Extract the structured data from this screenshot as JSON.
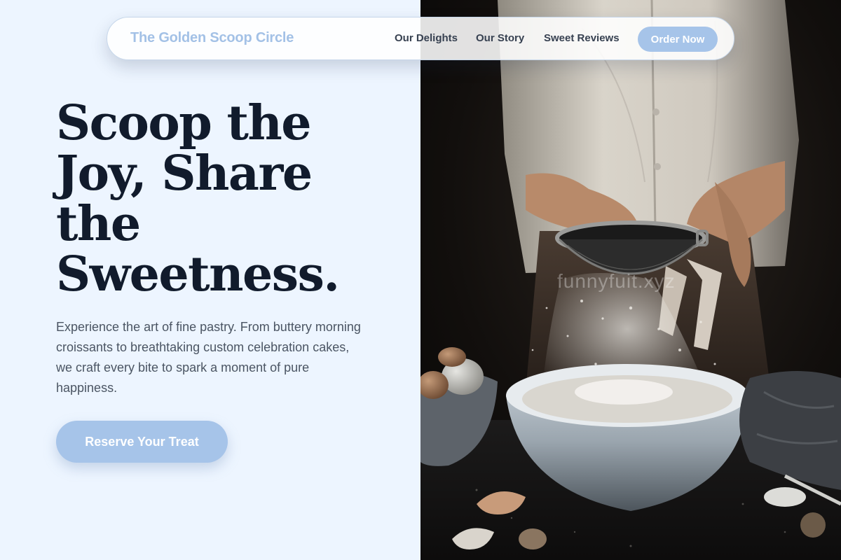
{
  "nav": {
    "brand": "The Golden Scoop Circle",
    "links": [
      "Our Delights",
      "Our Story",
      "Sweet Reviews"
    ],
    "cta": "Order Now"
  },
  "hero": {
    "title_lines": [
      "Scoop the",
      "Joy, Share",
      "the",
      "Sweetness."
    ],
    "description": "Experience the art of fine pastry. From buttery morning croissants to breathtaking custom celebration cakes, we craft every bite to spark a moment of pure happiness.",
    "cta": "Reserve Your Treat"
  },
  "photo": {
    "watermark": "funnyfuit.xyz"
  },
  "colors": {
    "page_background": "#edf5ff",
    "accent": "#a6c4e9",
    "heading": "#111b2c",
    "body_text": "#4b5563"
  }
}
